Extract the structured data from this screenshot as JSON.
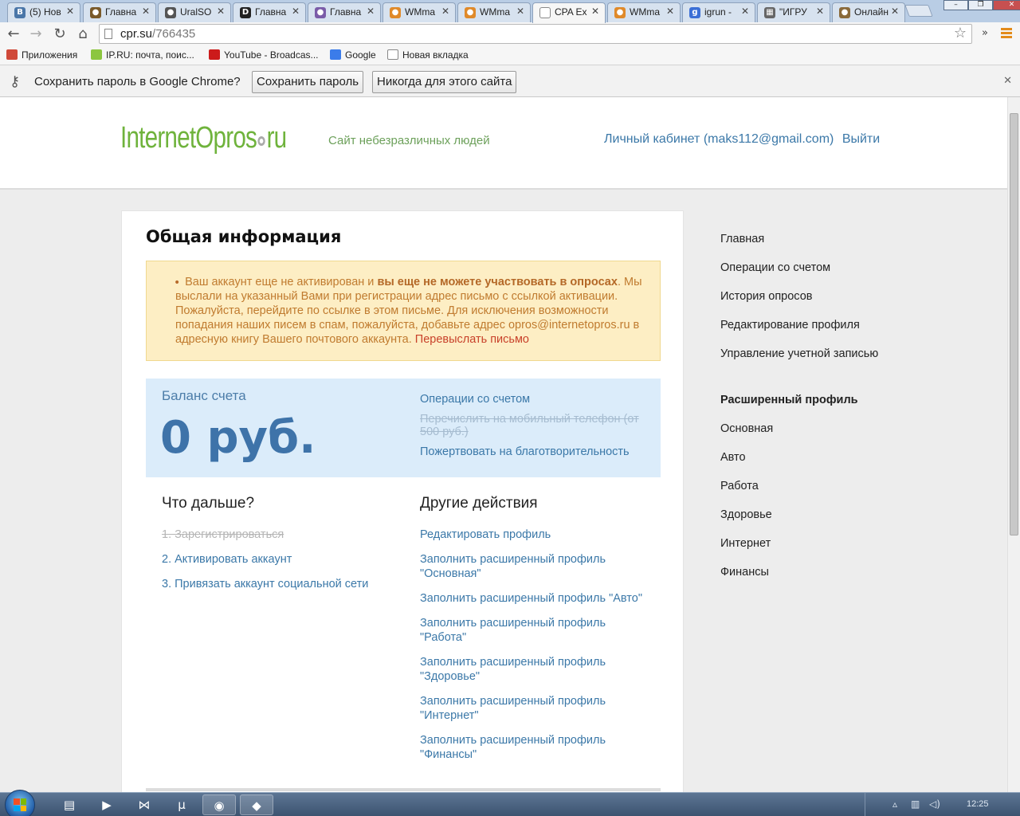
{
  "tabs": [
    {
      "label": "(5) Нов",
      "icon": "vk-icon",
      "color": "#4a76a8",
      "glyph": "В"
    },
    {
      "label": "Главна",
      "icon": "site-icon",
      "color": "#7a5a2a",
      "glyph": "●"
    },
    {
      "label": "UralSO",
      "icon": "site-icon",
      "color": "#555555",
      "glyph": "●"
    },
    {
      "label": "Главна",
      "icon": "d-icon",
      "color": "#222222",
      "glyph": "D"
    },
    {
      "label": "Главна",
      "icon": "site-icon",
      "color": "#7b5ca8",
      "glyph": "●"
    },
    {
      "label": "WMma",
      "icon": "wm-icon",
      "color": "#e08a2a",
      "glyph": "●"
    },
    {
      "label": "WMma",
      "icon": "wm-icon",
      "color": "#e08a2a",
      "glyph": "●"
    },
    {
      "label": "CPA Ex",
      "icon": "page-icon",
      "color": "#ffffff",
      "glyph": ""
    },
    {
      "label": "WMma",
      "icon": "wm-icon",
      "color": "#e08a2a",
      "glyph": "●"
    },
    {
      "label": "igrun -",
      "icon": "g-icon",
      "color": "#3b6fd6",
      "glyph": "g"
    },
    {
      "label": "\"ИГРУ",
      "icon": "chess-icon",
      "color": "#666666",
      "glyph": "▦"
    },
    {
      "label": "Онлайн",
      "icon": "site-icon",
      "color": "#8a6a3a",
      "glyph": "●"
    }
  ],
  "address": {
    "host": "cpr.su",
    "path": "/766435"
  },
  "bookmarks": [
    {
      "label": "Приложения",
      "icon": "apps-icon",
      "color": "#d04a3a"
    },
    {
      "label": "IP.RU: почта, поис...",
      "icon": "ip-icon",
      "color": "#8cc63f"
    },
    {
      "label": "YouTube - Broadcas...",
      "icon": "youtube-icon",
      "color": "#cc1b1b"
    },
    {
      "label": "Google",
      "icon": "google-icon",
      "color": "#3b7cea"
    },
    {
      "label": "Новая вкладка",
      "icon": "page-icon",
      "color": "#ffffff"
    }
  ],
  "infobar": {
    "message": "Сохранить пароль в Google Chrome?",
    "save_label": "Сохранить пароль",
    "never_label": "Никогда для этого сайта"
  },
  "site": {
    "logo_left": "InternetOpros",
    "logo_right": "ru",
    "tagline": "Сайт небезразличных людей",
    "account_label": "Личный кабинет (maks112@gmail.com)",
    "logout_label": "Выйти"
  },
  "main": {
    "title": "Общая информация",
    "notice": {
      "part1": "Ваш аккаунт еще не активирован и ",
      "bold": "вы еще не можете участвовать в опросах",
      "part2": ". Мы выслали на указанный Вами при регистрации адрес письмо с ссылкой активации. Пожалуйста, перейдите по ссылке в этом письме. Для исключения возможности попадания наших писем в спам, пожалуйста, добавьте адрес opros@internetopros.ru в адресную книгу Вашего почтового аккаунта. ",
      "resend": "Перевыслать письмо"
    },
    "balance": {
      "label": "Баланс счета",
      "amount": "0 руб.",
      "links": [
        {
          "label": "Операции со счетом",
          "strike": false
        },
        {
          "label": "Перечислить на мобильный телефон (от 500 руб.)",
          "strike": true
        },
        {
          "label": "Пожертвовать на благотворительность",
          "strike": false
        }
      ]
    },
    "next_title": "Что дальше?",
    "next_steps": [
      {
        "label": "1. Зарегистрироваться",
        "strike": true
      },
      {
        "label": "2. Активировать аккаунт",
        "strike": false
      },
      {
        "label": "3. Привязать аккаунт социальной сети",
        "strike": false
      }
    ],
    "other_title": "Другие действия",
    "other_actions": [
      "Редактировать профиль",
      "Заполнить расширенный профиль \"Основная\"",
      "Заполнить расширенный профиль \"Авто\"",
      "Заполнить расширенный профиль \"Работа\"",
      "Заполнить расширенный профиль \"Здоровье\"",
      "Заполнить расширенный профиль \"Интернет\"",
      "Заполнить расширенный профиль \"Финансы\""
    ]
  },
  "sidebar": {
    "items": [
      "Главная",
      "Операции со счетом",
      "История опросов",
      "Редактирование профиля",
      "Управление учетной записью"
    ],
    "ext_title": "Расширенный профиль",
    "ext_items": [
      "Основная",
      "Авто",
      "Работа",
      "Здоровье",
      "Интернет",
      "Финансы"
    ]
  },
  "taskbar": {
    "clock": "12:25",
    "apps": [
      {
        "name": "explorer-icon",
        "glyph": "▤"
      },
      {
        "name": "media-player-icon",
        "glyph": "▶"
      },
      {
        "name": "visual-studio-icon",
        "glyph": "⋈"
      },
      {
        "name": "utorrent-icon",
        "glyph": "μ"
      },
      {
        "name": "chrome-icon",
        "glyph": "◉"
      },
      {
        "name": "app-icon",
        "glyph": "◆"
      }
    ]
  }
}
